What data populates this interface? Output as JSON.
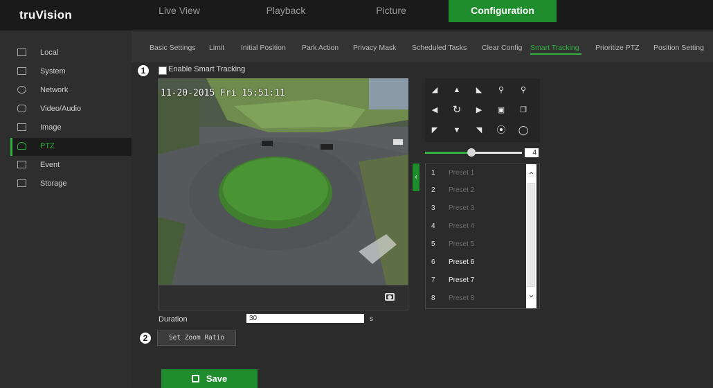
{
  "header": {
    "logo": "truVision",
    "tabs": [
      {
        "label": "Live View"
      },
      {
        "label": "Playback"
      },
      {
        "label": "Picture"
      },
      {
        "label": "Configuration"
      }
    ]
  },
  "sidebar": {
    "items": [
      {
        "label": "Local"
      },
      {
        "label": "System"
      },
      {
        "label": "Network"
      },
      {
        "label": "Video/Audio"
      },
      {
        "label": "Image"
      },
      {
        "label": "PTZ"
      },
      {
        "label": "Event"
      },
      {
        "label": "Storage"
      }
    ]
  },
  "subtabs": [
    "Basic Settings",
    "Limit",
    "Initial Position",
    "Park Action",
    "Privacy Mask",
    "Scheduled Tasks",
    "Clear Config",
    "Smart Tracking",
    "Prioritize PTZ",
    "Position Setting"
  ],
  "colors": {
    "accent": "#1f8c2e",
    "accent_text": "#2db33e",
    "background": "#2b2b2b",
    "topbar": "#1a1a1a"
  },
  "callouts": {
    "one": "1",
    "two": "2"
  },
  "smart_tracking": {
    "enable_label": "Enable Smart Tracking",
    "checked": false
  },
  "video": {
    "timestamp": "11-20-2015 Fri 15:51:11",
    "snapshot_icon": "camera-icon"
  },
  "ptz": {
    "speed": "4",
    "speed_level": 0.45,
    "controls": [
      "up-left-arrow-icon",
      "up-arrow-icon",
      "up-right-arrow-icon",
      "zoom-in-icon",
      "zoom-out-icon",
      "left-arrow-icon",
      "auto-pan-icon",
      "right-arrow-icon",
      "focus-near-icon",
      "focus-far-icon",
      "down-left-arrow-icon",
      "down-arrow-icon",
      "down-right-arrow-icon",
      "iris-open-icon",
      "iris-close-icon"
    ],
    "presets": [
      {
        "num": "1",
        "label": "Preset 1"
      },
      {
        "num": "2",
        "label": "Preset 2"
      },
      {
        "num": "3",
        "label": "Preset 3"
      },
      {
        "num": "4",
        "label": "Preset 4"
      },
      {
        "num": "5",
        "label": "Preset 5"
      },
      {
        "num": "6",
        "label": "Preset 6"
      },
      {
        "num": "7",
        "label": "Preset 7"
      },
      {
        "num": "8",
        "label": "Preset 8"
      }
    ]
  },
  "duration": {
    "label": "Duration",
    "value": "30",
    "unit": "s"
  },
  "zoom_button": "Set Zoom Ratio",
  "save_button": "Save"
}
